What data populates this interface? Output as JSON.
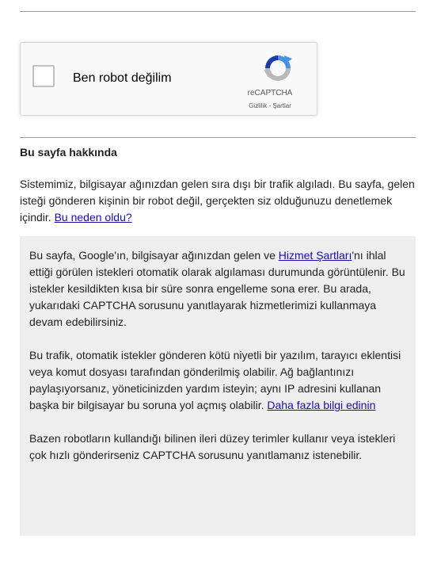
{
  "recaptcha": {
    "checkbox_label": "Ben robot değilim",
    "brand": "reCAPTCHA",
    "privacy_link": "Gizlilik",
    "separator": " - ",
    "terms_link": "Şartlar"
  },
  "about": {
    "heading": "Bu sayfa hakkında",
    "intro_text": "Sistemimiz, bilgisayar ağınızdan gelen sıra dışı bir trafik algıladı. Bu sayfa, gelen isteği gönderen kişinin bir robot değil, gerçekten siz olduğunuzu denetlemek içindir.",
    "intro_link": "Bu neden oldu?"
  },
  "info": {
    "p1_before": "Bu sayfa, Google'ın, bilgisayar ağınızdan gelen ve ",
    "p1_link": "Hizmet Şartları",
    "p1_after": "'nı ihlal ettiği görülen istekleri otomatik olarak algılaması durumunda görüntülenir. Bu istekler kesildikten kısa bir süre sonra engelleme sona erer. Bu arada, yukarıdaki CAPTCHA sorusunu yanıtlayarak hizmetlerimizi kullanmaya devam edebilirsiniz.",
    "p2_text": "Bu trafik, otomatik istekler gönderen kötü niyetli bir yazılım, tarayıcı eklentisi veya komut dosyası tarafından gönderilmiş olabilir. Ağ bağlantınızı paylaşıyorsanız, yöneticinizden yardım isteyin; aynı IP adresini kullanan başka bir bilgisayar bu soruna yol açmış olabilir.",
    "p2_link": "Daha fazla bilgi edinin",
    "p3_text": "Bazen robotların kullandığı bilinen ileri düzey terimler kullanır veya istekleri çok hızlı gönderirseniz CAPTCHA sorusunu yanıtlamanız istenebilir."
  },
  "colors": {
    "link": "#1a0dab",
    "info_background": "#eeeeee",
    "recaptcha_blue": "#4a90e2"
  },
  "icons": {
    "recaptcha_logo": "recaptcha-logo-icon"
  }
}
